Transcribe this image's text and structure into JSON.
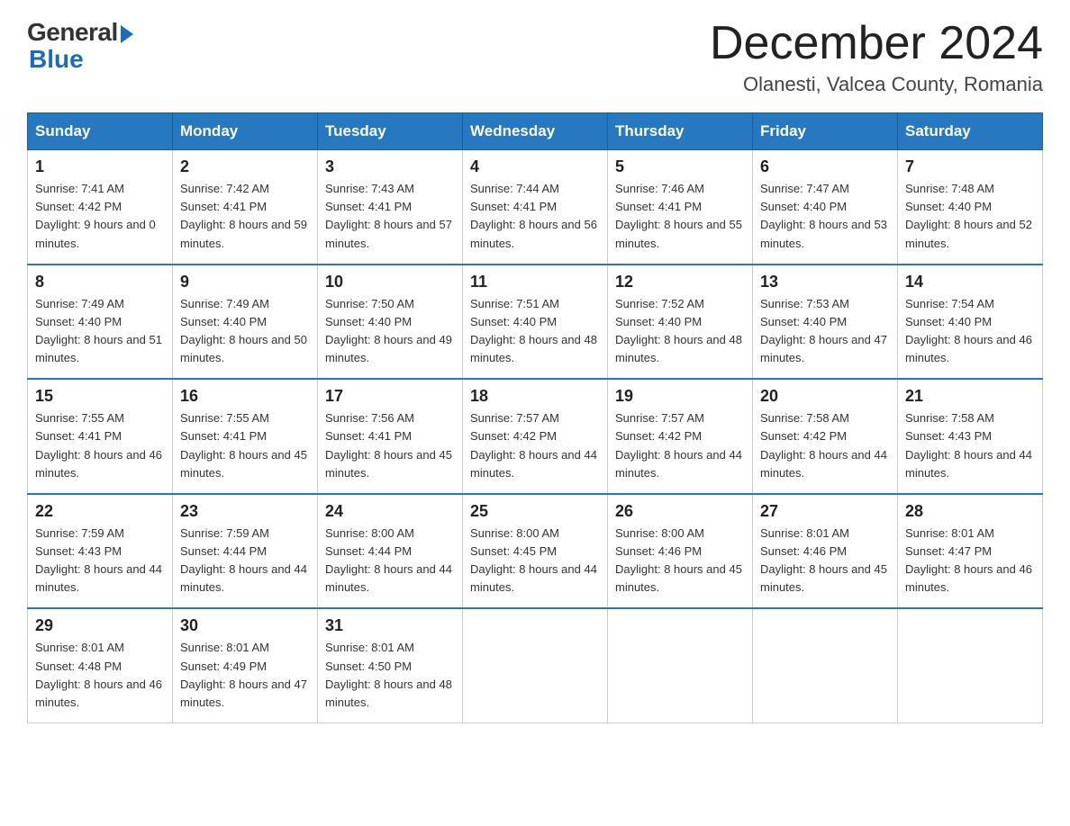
{
  "logo": {
    "general": "General",
    "blue": "Blue"
  },
  "title": "December 2024",
  "subtitle": "Olanesti, Valcea County, Romania",
  "weekdays": [
    "Sunday",
    "Monday",
    "Tuesday",
    "Wednesday",
    "Thursday",
    "Friday",
    "Saturday"
  ],
  "weeks": [
    [
      {
        "day": "1",
        "sunrise": "7:41 AM",
        "sunset": "4:42 PM",
        "daylight": "9 hours and 0 minutes."
      },
      {
        "day": "2",
        "sunrise": "7:42 AM",
        "sunset": "4:41 PM",
        "daylight": "8 hours and 59 minutes."
      },
      {
        "day": "3",
        "sunrise": "7:43 AM",
        "sunset": "4:41 PM",
        "daylight": "8 hours and 57 minutes."
      },
      {
        "day": "4",
        "sunrise": "7:44 AM",
        "sunset": "4:41 PM",
        "daylight": "8 hours and 56 minutes."
      },
      {
        "day": "5",
        "sunrise": "7:46 AM",
        "sunset": "4:41 PM",
        "daylight": "8 hours and 55 minutes."
      },
      {
        "day": "6",
        "sunrise": "7:47 AM",
        "sunset": "4:40 PM",
        "daylight": "8 hours and 53 minutes."
      },
      {
        "day": "7",
        "sunrise": "7:48 AM",
        "sunset": "4:40 PM",
        "daylight": "8 hours and 52 minutes."
      }
    ],
    [
      {
        "day": "8",
        "sunrise": "7:49 AM",
        "sunset": "4:40 PM",
        "daylight": "8 hours and 51 minutes."
      },
      {
        "day": "9",
        "sunrise": "7:49 AM",
        "sunset": "4:40 PM",
        "daylight": "8 hours and 50 minutes."
      },
      {
        "day": "10",
        "sunrise": "7:50 AM",
        "sunset": "4:40 PM",
        "daylight": "8 hours and 49 minutes."
      },
      {
        "day": "11",
        "sunrise": "7:51 AM",
        "sunset": "4:40 PM",
        "daylight": "8 hours and 48 minutes."
      },
      {
        "day": "12",
        "sunrise": "7:52 AM",
        "sunset": "4:40 PM",
        "daylight": "8 hours and 48 minutes."
      },
      {
        "day": "13",
        "sunrise": "7:53 AM",
        "sunset": "4:40 PM",
        "daylight": "8 hours and 47 minutes."
      },
      {
        "day": "14",
        "sunrise": "7:54 AM",
        "sunset": "4:40 PM",
        "daylight": "8 hours and 46 minutes."
      }
    ],
    [
      {
        "day": "15",
        "sunrise": "7:55 AM",
        "sunset": "4:41 PM",
        "daylight": "8 hours and 46 minutes."
      },
      {
        "day": "16",
        "sunrise": "7:55 AM",
        "sunset": "4:41 PM",
        "daylight": "8 hours and 45 minutes."
      },
      {
        "day": "17",
        "sunrise": "7:56 AM",
        "sunset": "4:41 PM",
        "daylight": "8 hours and 45 minutes."
      },
      {
        "day": "18",
        "sunrise": "7:57 AM",
        "sunset": "4:42 PM",
        "daylight": "8 hours and 44 minutes."
      },
      {
        "day": "19",
        "sunrise": "7:57 AM",
        "sunset": "4:42 PM",
        "daylight": "8 hours and 44 minutes."
      },
      {
        "day": "20",
        "sunrise": "7:58 AM",
        "sunset": "4:42 PM",
        "daylight": "8 hours and 44 minutes."
      },
      {
        "day": "21",
        "sunrise": "7:58 AM",
        "sunset": "4:43 PM",
        "daylight": "8 hours and 44 minutes."
      }
    ],
    [
      {
        "day": "22",
        "sunrise": "7:59 AM",
        "sunset": "4:43 PM",
        "daylight": "8 hours and 44 minutes."
      },
      {
        "day": "23",
        "sunrise": "7:59 AM",
        "sunset": "4:44 PM",
        "daylight": "8 hours and 44 minutes."
      },
      {
        "day": "24",
        "sunrise": "8:00 AM",
        "sunset": "4:44 PM",
        "daylight": "8 hours and 44 minutes."
      },
      {
        "day": "25",
        "sunrise": "8:00 AM",
        "sunset": "4:45 PM",
        "daylight": "8 hours and 44 minutes."
      },
      {
        "day": "26",
        "sunrise": "8:00 AM",
        "sunset": "4:46 PM",
        "daylight": "8 hours and 45 minutes."
      },
      {
        "day": "27",
        "sunrise": "8:01 AM",
        "sunset": "4:46 PM",
        "daylight": "8 hours and 45 minutes."
      },
      {
        "day": "28",
        "sunrise": "8:01 AM",
        "sunset": "4:47 PM",
        "daylight": "8 hours and 46 minutes."
      }
    ],
    [
      {
        "day": "29",
        "sunrise": "8:01 AM",
        "sunset": "4:48 PM",
        "daylight": "8 hours and 46 minutes."
      },
      {
        "day": "30",
        "sunrise": "8:01 AM",
        "sunset": "4:49 PM",
        "daylight": "8 hours and 47 minutes."
      },
      {
        "day": "31",
        "sunrise": "8:01 AM",
        "sunset": "4:50 PM",
        "daylight": "8 hours and 48 minutes."
      },
      null,
      null,
      null,
      null
    ]
  ]
}
